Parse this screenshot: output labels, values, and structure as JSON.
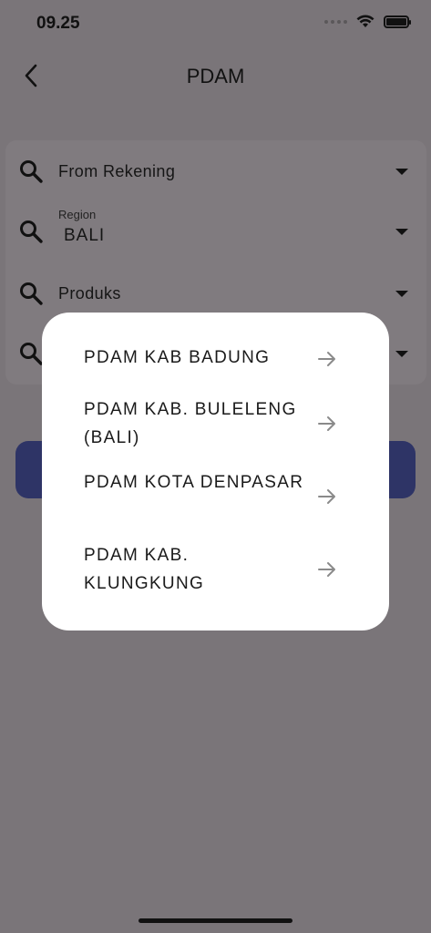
{
  "status_bar": {
    "time": "09.25",
    "icons": [
      "signal-icon",
      "wifi-icon",
      "battery-icon"
    ]
  },
  "header": {
    "title": "PDAM",
    "back_icon": "chevron-left-icon"
  },
  "form": {
    "from_rekening": {
      "text": "From Rekening",
      "icon": "search-icon"
    },
    "region": {
      "label": "Region",
      "value": "BALI",
      "icon": "search-icon"
    },
    "produks": {
      "text": "Produks",
      "icon": "search-icon"
    },
    "fourth": {
      "text": "",
      "icon": "search-icon"
    }
  },
  "modal": {
    "options": [
      {
        "label": "PDAM KAB BADUNG",
        "icon": "arrow-right-icon"
      },
      {
        "label": "PDAM KAB. BULELENG (BALI)",
        "icon": "arrow-right-icon"
      },
      {
        "label": "PDAM KOTA DENPASAR",
        "icon": "arrow-right-icon"
      },
      {
        "label": "PDAM KAB. KLUNGKUNG",
        "icon": "arrow-right-icon"
      }
    ]
  },
  "colors": {
    "overlay_background": "#7a7579",
    "modal_background": "#ffffff",
    "button_primary_dimmed": "#2e3466",
    "arrow": "#8a8a8a"
  }
}
